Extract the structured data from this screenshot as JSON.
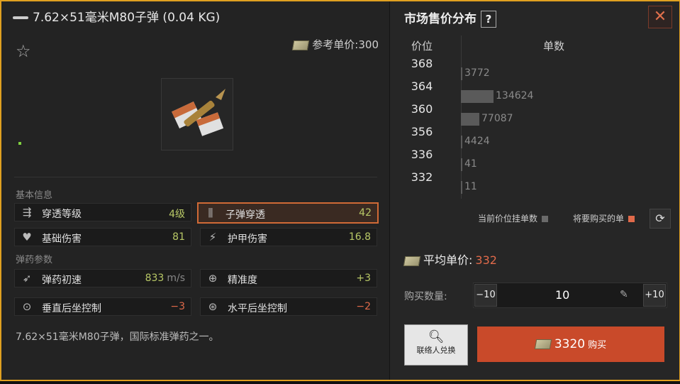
{
  "item": {
    "title": "7.62×51毫米M80子弹 (0.04 KG)",
    "ref_price_label": "参考单价:",
    "ref_price": "300",
    "description": "7.62×51毫米M80子弹，国际标准弹药之一。"
  },
  "sections": {
    "basic": "基本信息",
    "ammo": "弹药参数"
  },
  "stats": {
    "penetration_level": {
      "label": "穿透等级",
      "value": "4级"
    },
    "bullet_penetration": {
      "label": "子弹穿透",
      "value": "42"
    },
    "base_damage": {
      "label": "基础伤害",
      "value": "81"
    },
    "armor_damage": {
      "label": "护甲伤害",
      "value": "16.8"
    },
    "muzzle_velocity": {
      "label": "弹药初速",
      "value": "833",
      "unit": "m/s"
    },
    "accuracy": {
      "label": "精准度",
      "value": "+3"
    },
    "vertical_recoil": {
      "label": "垂直后坐控制",
      "value": "−3"
    },
    "horizontal_recoil": {
      "label": "水平后坐控制",
      "value": "−2"
    }
  },
  "market": {
    "title": "市场售价分布",
    "help": "?",
    "close": "✕",
    "col_price": "价位",
    "col_count": "单数",
    "legend_current": "当前价位挂单数",
    "legend_buy": "将要购买的单",
    "avg_label": "平均单价:",
    "avg_value": "332",
    "qty_label": "购买数量:",
    "minus10": "−10",
    "plus10": "+10",
    "qty_value": "10",
    "contact_label": "联络人兑换",
    "buy_total": "3320",
    "buy_label": "购买"
  },
  "chart_data": {
    "type": "bar",
    "categories": [
      "368",
      "364",
      "360",
      "356",
      "336",
      "332"
    ],
    "values": [
      3772,
      134624,
      77087,
      4424,
      41,
      11
    ],
    "xlabel": "单数",
    "ylabel": "价位"
  },
  "colors": {
    "accent_orange": "#e06a4a",
    "frame": "#e0a020",
    "positive": "#b8c866"
  }
}
